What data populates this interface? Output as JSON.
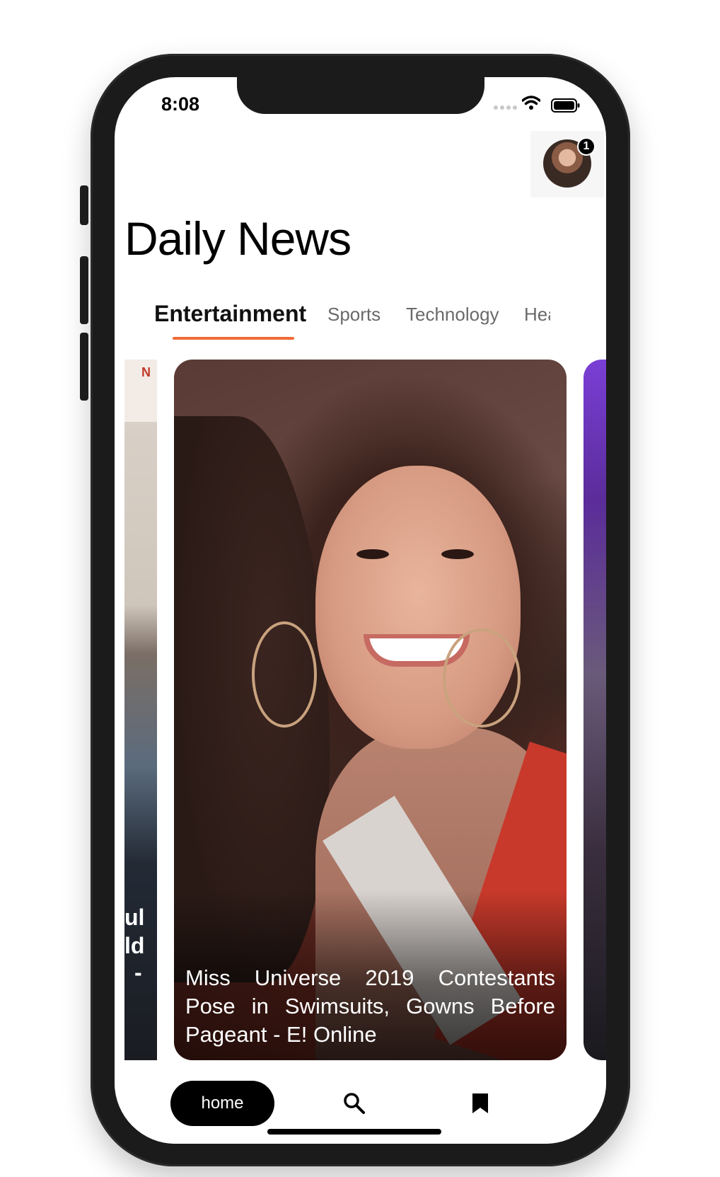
{
  "status_bar": {
    "time": "8:08"
  },
  "header": {
    "avatar_badge": "1",
    "title": "Daily News"
  },
  "tabs": [
    {
      "label": "Entertainment",
      "active": true
    },
    {
      "label": "Sports",
      "active": false
    },
    {
      "label": "Technology",
      "active": false
    },
    {
      "label": "Health",
      "active": false
    }
  ],
  "cards": {
    "left_partial_lines": [
      "ul",
      "ld",
      "-"
    ],
    "left_partial_top_text": "N",
    "main_headline": "Miss Universe 2019 Contestants Pose in Swimsuits, Gowns Before Pageant - E! Online"
  },
  "bottom_nav": {
    "home_label": "home",
    "search_icon": "search-icon",
    "bookmark_icon": "bookmark-icon"
  },
  "colors": {
    "accent": "#f26b3a",
    "nav_active_bg": "#000000"
  }
}
